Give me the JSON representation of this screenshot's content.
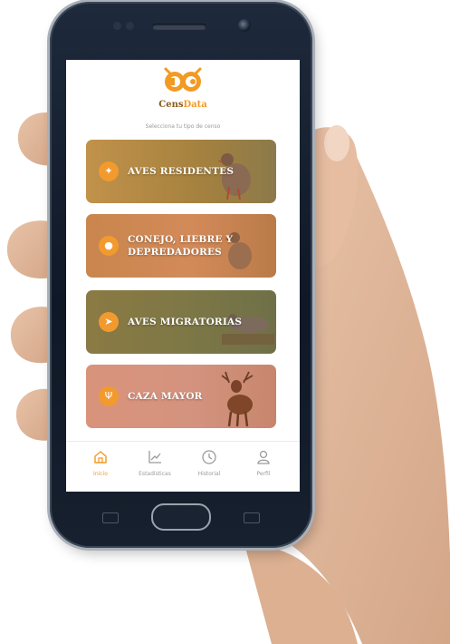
{
  "app": {
    "brand_part1": "Cens",
    "brand_part2": "Data",
    "prompt": "Selecciona tu tipo de censo"
  },
  "cards": [
    {
      "label_line1": "AVES RESIDENTES",
      "label_line2": "",
      "icon": "bird-icon",
      "color": "#b48a45"
    },
    {
      "label_line1": "CONEJO, LIEBRE Y",
      "label_line2": "DEPREDADORES",
      "icon": "paw-icon",
      "color": "#c48450"
    },
    {
      "label_line1": "AVES MIGRATORIAS",
      "label_line2": "",
      "icon": "flying-bird-icon",
      "color": "#8c7a45"
    },
    {
      "label_line1": "CAZA MAYOR",
      "label_line2": "",
      "icon": "antlers-icon",
      "color": "#c98b74"
    }
  ],
  "tabs": [
    {
      "label": "Inicio",
      "icon": "home-icon",
      "active": true
    },
    {
      "label": "Estadísticas",
      "icon": "chart-icon",
      "active": false
    },
    {
      "label": "Historial",
      "icon": "clock-icon",
      "active": false
    },
    {
      "label": "Perfil",
      "icon": "user-icon",
      "active": false
    }
  ],
  "colors": {
    "accent": "#f39a22",
    "brand_dark": "#8a5a1c",
    "phone_body": "#0f1826",
    "inactive_tab": "#9a9a9a"
  }
}
